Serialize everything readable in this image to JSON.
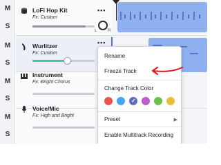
{
  "mute_label": "M",
  "solo_label": "S",
  "more_label": "•••",
  "pan_left": "L",
  "pan_right": "R",
  "tracks": [
    {
      "name": "LoFi Hop Kit",
      "fx": "Fx: Custom",
      "icon": "drum-kit-icon",
      "volume": 0.85
    },
    {
      "name": "Wurlitzer",
      "fx": "Fx: Custom",
      "icon": "keyboard-icon",
      "volume": 0.55,
      "color": "#3ec5a3"
    },
    {
      "name": "Instrument",
      "fx": "Fx: Bright Chorus",
      "icon": "piano-icon"
    },
    {
      "name": "Voice/Mic",
      "fx": "Fx: High and Bright",
      "icon": "microphone-icon"
    }
  ],
  "menu": {
    "rename": "Rename",
    "freeze": "Freeze Track",
    "change_color": "Change Track Color",
    "colors": [
      "#ef5350",
      "#42a5f5",
      "#5c6bc0",
      "#c05cc9",
      "#6cc04a",
      "#e6c035"
    ],
    "selected_color_index": 2,
    "preset": "Preset",
    "multitrack": "Enable Multitrack Recording"
  },
  "accent_color": "#8fb0ee",
  "annotation_color": "#e0161c"
}
